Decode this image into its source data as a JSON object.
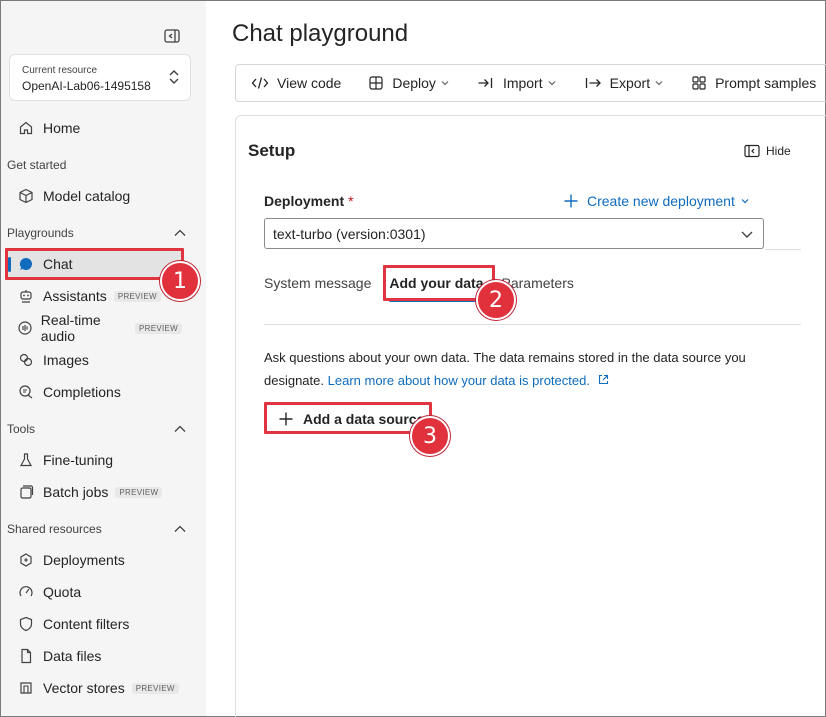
{
  "sidebar": {
    "resource_label": "Current resource",
    "resource_value": "OpenAI-Lab06-1495158",
    "items": {
      "home": "Home",
      "model_catalog": "Model catalog",
      "chat": "Chat",
      "assistants": "Assistants",
      "realtime_audio": "Real-time audio",
      "images": "Images",
      "completions": "Completions",
      "fine_tuning": "Fine-tuning",
      "batch_jobs": "Batch jobs",
      "deployments": "Deployments",
      "quota": "Quota",
      "content_filters": "Content filters",
      "data_files": "Data files",
      "vector_stores": "Vector stores"
    },
    "badges": {
      "preview": "PREVIEW"
    },
    "sections": {
      "get_started": "Get started",
      "playgrounds": "Playgrounds",
      "tools": "Tools",
      "shared_resources": "Shared resources"
    }
  },
  "main": {
    "title": "Chat playground",
    "toolbar": {
      "view_code": "View code",
      "deploy": "Deploy",
      "import": "Import",
      "export": "Export",
      "prompt_samples": "Prompt samples"
    },
    "setup": {
      "title": "Setup",
      "hide": "Hide",
      "deployment_label": "Deployment",
      "required_mark": "*",
      "create_new": "Create new deployment",
      "deployment_value": "text-turbo (version:0301)",
      "tabs": [
        "System message",
        "Add your data",
        "Parameters"
      ],
      "description": "Ask questions about your own data. The data remains stored in the data source you designate.",
      "learn_more": "Learn more about how your data is protected.",
      "add_source": "Add a data source"
    }
  },
  "callouts": [
    "1",
    "2",
    "3"
  ],
  "colors": {
    "accent": "#0f6cbd",
    "highlight": "#e03540",
    "sidebar_bg": "#f5f5f5"
  }
}
